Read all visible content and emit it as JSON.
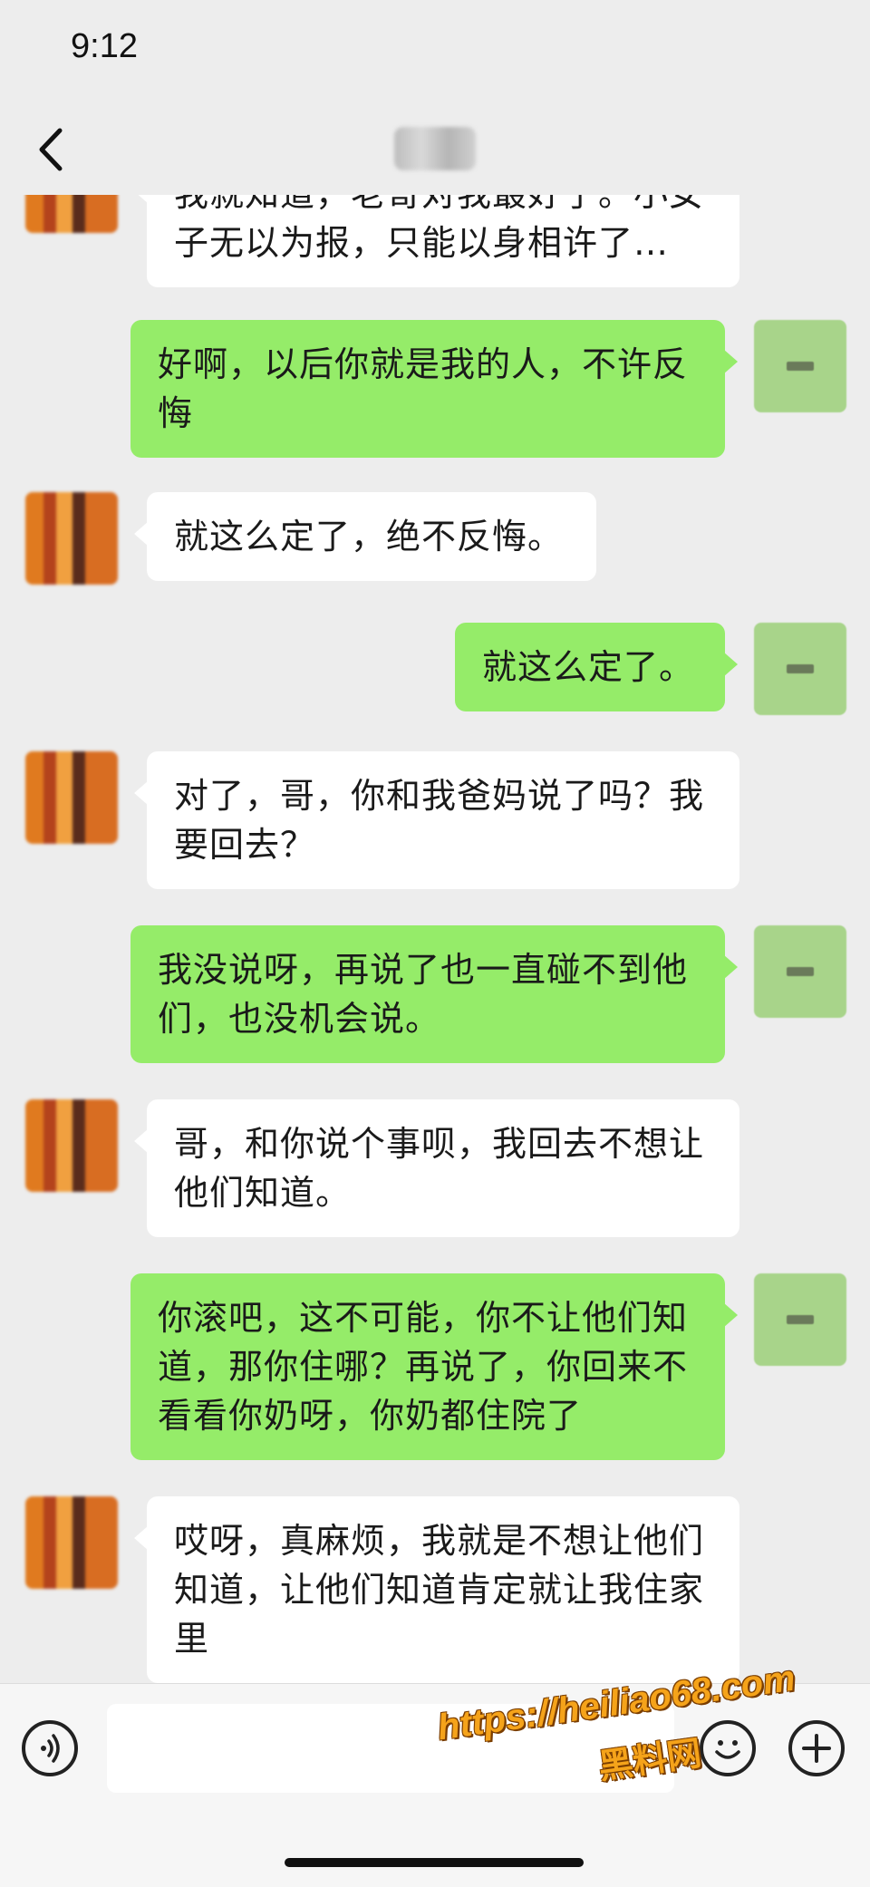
{
  "status_bar": {
    "time": "9:12"
  },
  "header": {
    "back_icon": "chevron-left-icon",
    "title": "晓晓"
  },
  "messages": [
    {
      "sender": "them",
      "text": "我就知道，老哥对我最好了。小女子无以为报，只能以身相许了…"
    },
    {
      "sender": "me",
      "text": "好啊，以后你就是我的人，不许反悔"
    },
    {
      "sender": "them",
      "text": "就这么定了，绝不反悔。"
    },
    {
      "sender": "me",
      "text": "就这么定了。"
    },
    {
      "sender": "them",
      "text": "对了，哥，你和我爸妈说了吗？我要回去？"
    },
    {
      "sender": "me",
      "text": "我没说呀，再说了也一直碰不到他们，也没机会说。"
    },
    {
      "sender": "them",
      "text": "哥，和你说个事呗，我回去不想让他们知道。"
    },
    {
      "sender": "me",
      "text": "你滚吧，这不可能，你不让他们知道，那你住哪？再说了，你回来不看看你奶呀，你奶都住院了"
    },
    {
      "sender": "them",
      "text": "哎呀，真麻烦，我就是不想让他们知道，让他们知道肯定就让我住家里"
    }
  ],
  "input_bar": {
    "voice_icon": "voice-icon",
    "input_value": "",
    "emoji_icon": "emoji-icon",
    "plus_icon": "plus-icon"
  },
  "watermark": {
    "url": "https://heiliao68.com",
    "name": "黑料网"
  },
  "colors": {
    "background": "#ededed",
    "my_bubble": "#95ec69",
    "their_bubble": "#ffffff",
    "watermark": "#f5a31a"
  }
}
